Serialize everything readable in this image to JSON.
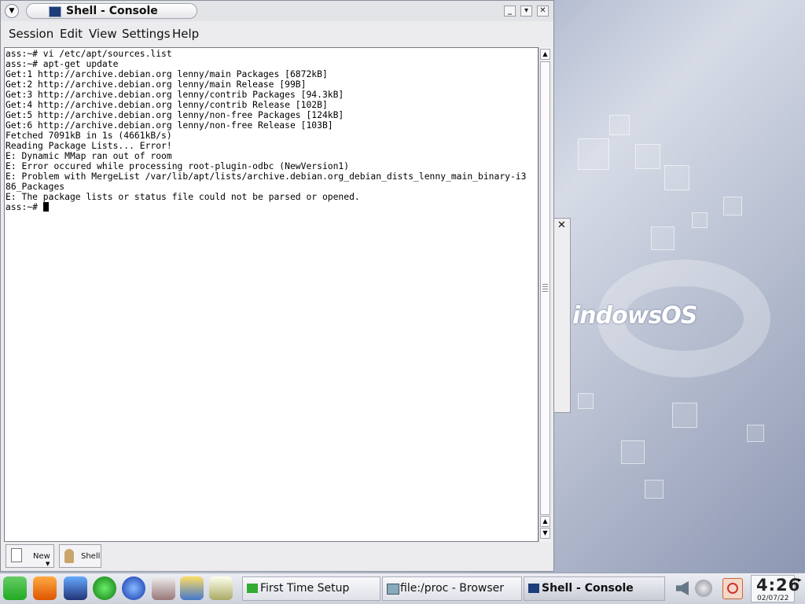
{
  "window": {
    "title": "Shell - Console",
    "menu": [
      "Session",
      "Edit",
      "View",
      "Settings",
      "Help"
    ],
    "terminal_lines": [
      "ass:~# vi /etc/apt/sources.list",
      "ass:~# apt-get update",
      "Get:1 http://archive.debian.org lenny/main Packages [6872kB]",
      "Get:2 http://archive.debian.org lenny/main Release [99B]",
      "Get:3 http://archive.debian.org lenny/contrib Packages [94.3kB]",
      "Get:4 http://archive.debian.org lenny/contrib Release [102B]",
      "Get:5 http://archive.debian.org lenny/non-free Packages [124kB]",
      "Get:6 http://archive.debian.org lenny/non-free Release [103B]",
      "Fetched 7091kB in 1s (4661kB/s)",
      "Reading Package Lists... Error!",
      "E: Dynamic MMap ran out of room",
      "E: Error occured while processing root-plugin-odbc (NewVersion1)",
      "E: Problem with MergeList /var/lib/apt/lists/archive.debian.org_debian_dists_lenny_main_binary-i3",
      "86_Packages",
      "E: The package lists or status file could not be parsed or opened."
    ],
    "prompt": "ass:~# ",
    "tabs": {
      "new_label": "New",
      "shell_label": "Shell"
    }
  },
  "desktop": {
    "logo_text": "indowsOS"
  },
  "taskbar": {
    "tasks": [
      {
        "label": "First Time Setup",
        "icon": "setup-icon"
      },
      {
        "label": "file:/proc - Browser",
        "icon": "folder-icon"
      },
      {
        "label": "Shell - Console",
        "icon": "console-icon",
        "active": true
      }
    ],
    "clock": {
      "time": "4:26",
      "date": "02/07/22"
    }
  },
  "colors": {
    "accent": "#1d3d7a",
    "desktop": "#a9b3ca"
  }
}
